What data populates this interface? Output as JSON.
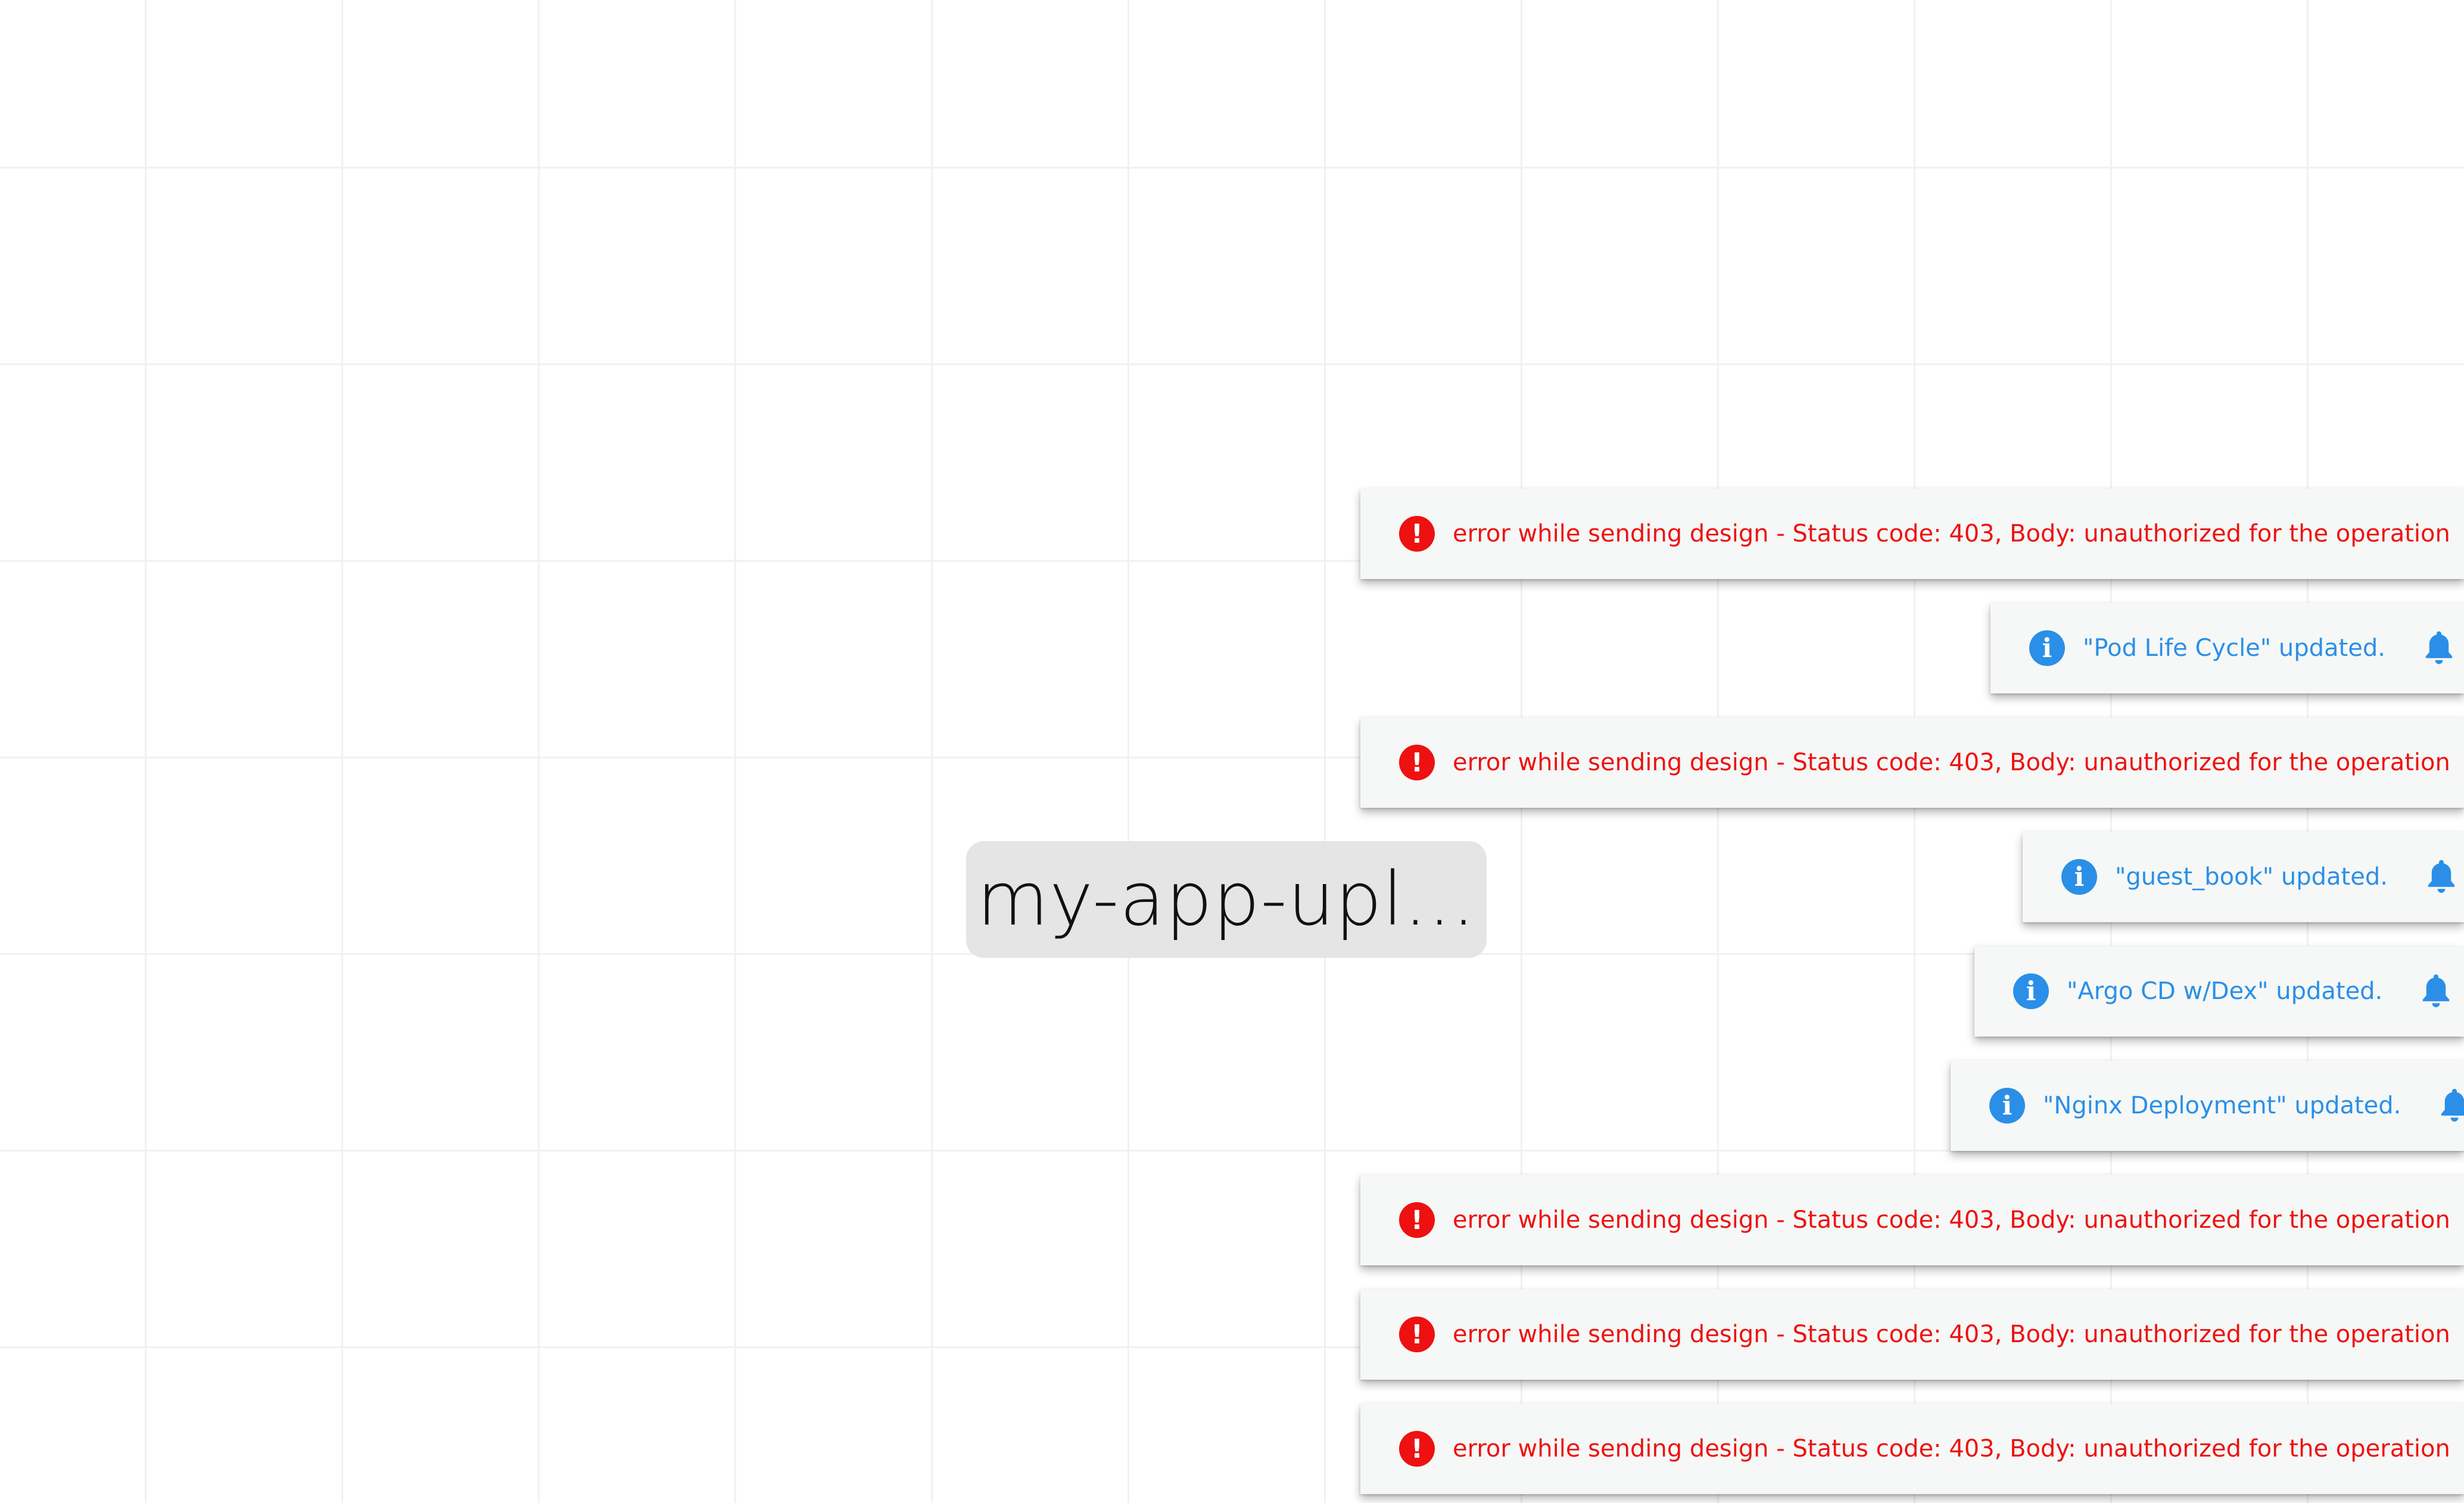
{
  "canvas": {
    "node_label": "my-app-upl..."
  },
  "notifications": [
    {
      "type": "error",
      "status_icon": "exclamation-icon",
      "message": "error while sending design - Status code: 403, Body: unauthorized for the operation",
      "bell_icon": "bell-icon"
    },
    {
      "type": "info",
      "status_icon": "info-icon",
      "message": "\"Pod Life Cycle\" updated.",
      "bell_icon": "bell-icon"
    },
    {
      "type": "error",
      "status_icon": "exclamation-icon",
      "message": "error while sending design - Status code: 403, Body: unauthorized for the operation",
      "bell_icon": "bell-icon"
    },
    {
      "type": "info",
      "status_icon": "info-icon",
      "message": "\"guest_book\" updated.",
      "bell_icon": "bell-icon"
    },
    {
      "type": "info",
      "status_icon": "info-icon",
      "message": "\"Argo CD w/Dex\" updated.",
      "bell_icon": "bell-icon"
    },
    {
      "type": "info",
      "status_icon": "info-icon",
      "message": "\"Nginx Deployment\" updated.",
      "bell_icon": "bell-icon"
    },
    {
      "type": "error",
      "status_icon": "exclamation-icon",
      "message": "error while sending design - Status code: 403, Body: unauthorized for the operation",
      "bell_icon": "bell-icon"
    },
    {
      "type": "error",
      "status_icon": "exclamation-icon",
      "message": "error while sending design - Status code: 403, Body: unauthorized for the operation",
      "bell_icon": "bell-icon"
    },
    {
      "type": "error",
      "status_icon": "exclamation-icon",
      "message": "error while sending design - Status code: 403, Body: unauthorized for the operation",
      "bell_icon": "bell-icon"
    }
  ],
  "colors": {
    "error": "#ee1111",
    "info": "#2b8fe8",
    "toast_background": "#f5f8f6",
    "node_background": "#e4e5e4"
  }
}
